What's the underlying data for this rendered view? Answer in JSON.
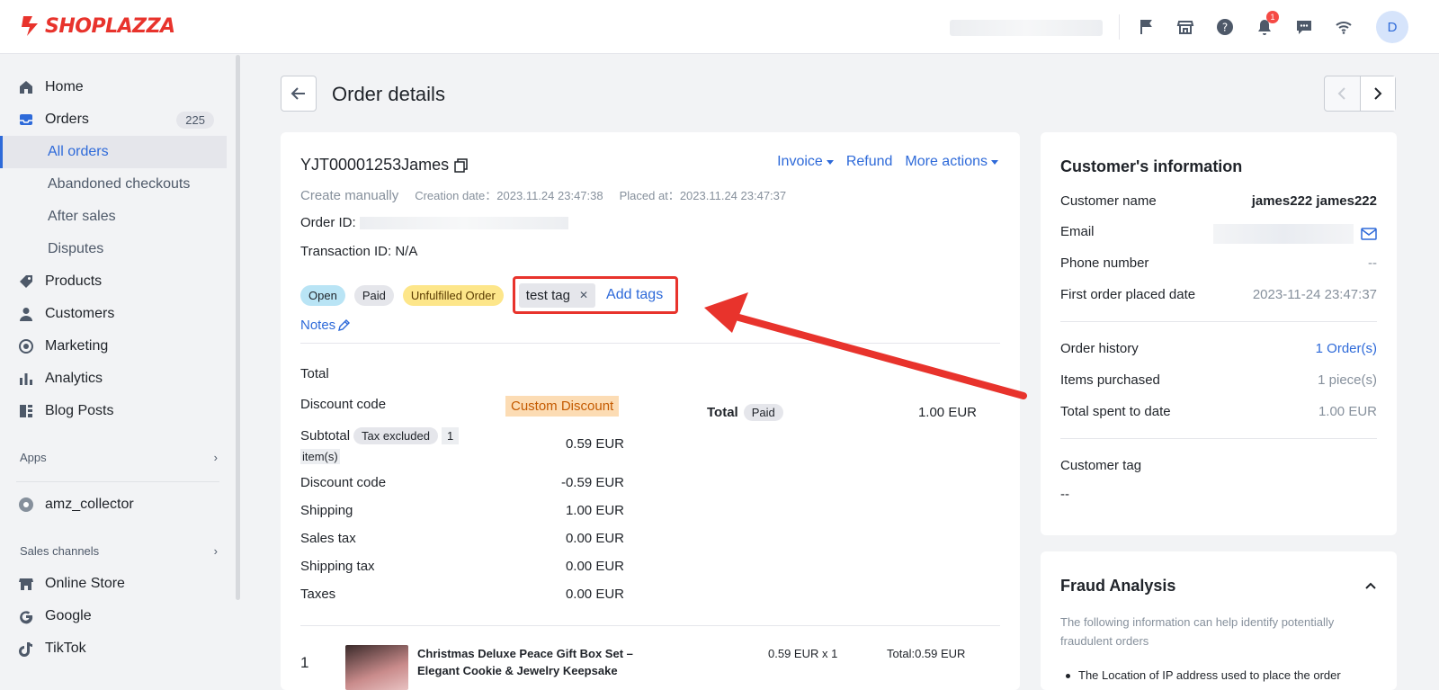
{
  "brand": {
    "name": "SHOPLAZZA",
    "accent": "#e8332c",
    "link": "#2e6ad9"
  },
  "topbar": {
    "notification_count": "1",
    "avatar_initial": "D"
  },
  "sidebar": {
    "items": [
      {
        "label": "Home",
        "icon": "home-icon"
      },
      {
        "label": "Orders",
        "icon": "inbox-icon",
        "count": "225"
      },
      {
        "label": "All orders"
      },
      {
        "label": "Abandoned checkouts"
      },
      {
        "label": "After sales"
      },
      {
        "label": "Disputes"
      },
      {
        "label": "Products",
        "icon": "tag-icon"
      },
      {
        "label": "Customers",
        "icon": "person-icon"
      },
      {
        "label": "Marketing",
        "icon": "target-icon"
      },
      {
        "label": "Analytics",
        "icon": "bar-chart-icon"
      },
      {
        "label": "Blog Posts",
        "icon": "blog-icon"
      }
    ],
    "apps_label": "Apps",
    "app_item": "amz_collector",
    "sales_channels_label": "Sales channels",
    "channels": [
      "Online Store",
      "Google",
      "TikTok"
    ]
  },
  "header": {
    "title": "Order details"
  },
  "order": {
    "number": "YJT00001253James",
    "actions": {
      "invoice": "Invoice",
      "refund": "Refund",
      "more": "More actions"
    },
    "source": "Create manually",
    "creation_label": "Creation date：",
    "creation_value": "2023.11.24 23:47:38",
    "placed_label": "Placed at：",
    "placed_value": "2023.11.24 23:47:37",
    "order_id_label": "Order ID:",
    "transaction": "Transaction ID: N/A",
    "status_pills": {
      "open": "Open",
      "paid": "Paid",
      "fulfillment": "Unfulfilled Order"
    },
    "tag": "test tag",
    "add_tags": "Add tags",
    "notes": "Notes"
  },
  "totals": {
    "title": "Total",
    "discount_code_label": "Discount code",
    "discount_name": "Custom Discount",
    "subtotal_label": "Subtotal",
    "tax_excluded": "Tax excluded",
    "items_count_a": "1",
    "items_count_b": "item(s)",
    "subtotal_value": "0.59 EUR",
    "discount_value": "-0.59 EUR",
    "shipping_label": "Shipping",
    "shipping_value": "1.00 EUR",
    "sales_tax_label": "Sales tax",
    "sales_tax_value": "0.00 EUR",
    "shipping_tax_label": "Shipping tax",
    "shipping_tax_value": "0.00 EUR",
    "taxes_label": "Taxes",
    "taxes_value": "0.00 EUR",
    "grand_label": "Total",
    "grand_status": "Paid",
    "grand_value": "1.00 EUR"
  },
  "line_item": {
    "index": "1",
    "title": "Christmas Deluxe Peace Gift Box Set – Elegant Cookie & Jewelry Keepsake",
    "qty": "0.59 EUR x 1",
    "total": "Total:0.59 EUR"
  },
  "customer": {
    "title": "Customer's information",
    "name_label": "Customer name",
    "name_value": "james222 james222",
    "email_label": "Email",
    "phone_label": "Phone number",
    "phone_value": "--",
    "first_order_label": "First order placed date",
    "first_order_value": "2023-11-24 23:47:37",
    "history_label": "Order history",
    "history_value": "1 Order(s)",
    "items_label": "Items purchased",
    "items_value": "1 piece(s)",
    "spent_label": "Total spent to date",
    "spent_value": "1.00 EUR",
    "tag_label": "Customer tag",
    "tag_value": "--"
  },
  "fraud": {
    "title": "Fraud Analysis",
    "description": "The following information can help identify potentially fraudulent orders",
    "bullet": "The Location of IP address used to place the order"
  }
}
